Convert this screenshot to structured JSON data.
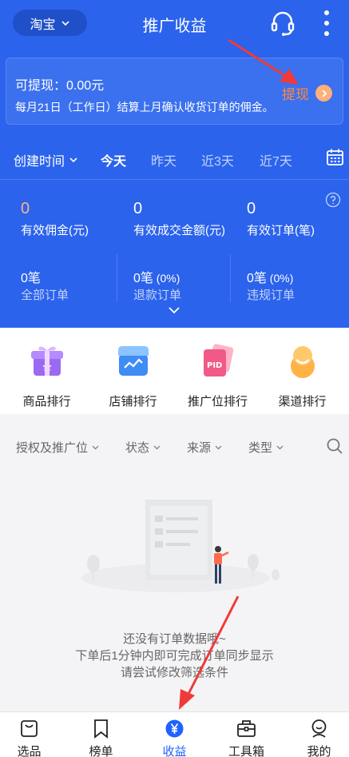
{
  "header": {
    "platform": "淘宝",
    "title": "推广收益",
    "support_icon": "headset-icon",
    "more_icon": "vertical-dots-icon"
  },
  "withdraw": {
    "amount_label": "可提现：0.00元",
    "note": "每月21日（工作日）结算上月确认收货订单的佣金。",
    "button_label": "提现"
  },
  "date_filter": {
    "dropdown_label": "创建时间",
    "options": [
      "今天",
      "昨天",
      "近3天",
      "近7天"
    ],
    "selected": "今天",
    "calendar_icon": "calendar-icon"
  },
  "stats": [
    {
      "value": "0",
      "label": "有效佣金(元)"
    },
    {
      "value": "0",
      "label": "有效成交金额(元)"
    },
    {
      "value": "0",
      "label": "有效订单(笔)"
    }
  ],
  "order_stats": [
    {
      "value": "0笔",
      "pct": "",
      "label": "全部订单"
    },
    {
      "value": "0笔",
      "pct": " (0%)",
      "label": "退款订单"
    },
    {
      "value": "0笔",
      "pct": " (0%)",
      "label": "违规订单"
    }
  ],
  "tools": [
    {
      "label": "商品排行",
      "icon": "gift-box-icon"
    },
    {
      "label": "店铺排行",
      "icon": "store-icon"
    },
    {
      "label": "推广位排行",
      "icon": "pid-card-icon"
    },
    {
      "label": "渠道排行",
      "icon": "avatar-channel-icon"
    }
  ],
  "list_filters": [
    "授权及推广位",
    "状态",
    "来源",
    "类型"
  ],
  "empty_state": {
    "line1": "还没有订单数据哦~",
    "line2": "下单后1分钟内即可完成订单同步显示",
    "line3": "请尝试修改筛选条件"
  },
  "tabs": [
    {
      "label": "选品",
      "icon": "bag-icon"
    },
    {
      "label": "榜单",
      "icon": "bookmark-icon"
    },
    {
      "label": "收益",
      "icon": "yen-coin-icon"
    },
    {
      "label": "工具箱",
      "icon": "toolbox-icon"
    },
    {
      "label": "我的",
      "icon": "user-icon"
    }
  ],
  "active_tab": "收益",
  "colors": {
    "primary_blue": "#2b63ec",
    "accent_orange": "#ff8a3d",
    "annotation_red": "#f03a3a",
    "tab_active": "#1f62ff"
  }
}
